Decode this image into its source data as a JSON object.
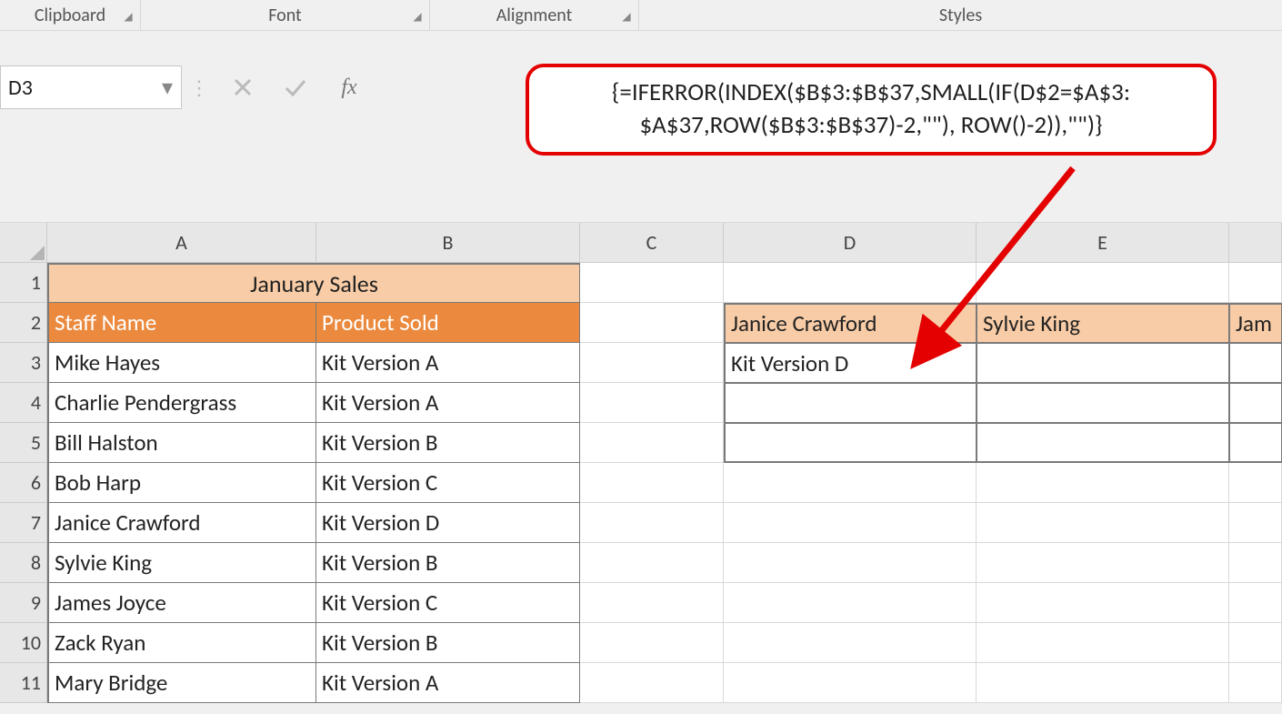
{
  "ribbon": {
    "clipboard": "Clipboard",
    "font": "Font",
    "alignment": "Alignment",
    "styles": "Styles"
  },
  "formula_bar": {
    "cell_ref": "D3",
    "fx_label": "fx",
    "formula_line1": "{=IFERROR(INDEX($B$3:$B$37,SMALL(IF(D$2=$A$3:",
    "formula_line2": "$A$37,ROW($B$3:$B$37)-2,\"\"), ROW()-2)),\"\")}"
  },
  "columns": [
    "A",
    "B",
    "C",
    "D",
    "E"
  ],
  "row_numbers": [
    "1",
    "2",
    "3",
    "4",
    "5",
    "6",
    "7",
    "8",
    "9",
    "10",
    "11"
  ],
  "grid": {
    "title": "January Sales",
    "header_a": "Staff Name",
    "header_b": "Product Sold",
    "rows": [
      {
        "a": "Mike Hayes",
        "b": "Kit Version A"
      },
      {
        "a": "Charlie Pendergrass",
        "b": "Kit Version A"
      },
      {
        "a": "Bill Halston",
        "b": "Kit Version B"
      },
      {
        "a": "Bob Harp",
        "b": "Kit Version C"
      },
      {
        "a": "Janice Crawford",
        "b": "Kit Version D"
      },
      {
        "a": "Sylvie King",
        "b": "Kit Version B"
      },
      {
        "a": "James Joyce",
        "b": "Kit Version C"
      },
      {
        "a": "Zack Ryan",
        "b": "Kit Version B"
      },
      {
        "a": "Mary Bridge",
        "b": "Kit Version A"
      }
    ],
    "lookup_d2": "Janice Crawford",
    "lookup_e2": "Sylvie King",
    "lookup_f2": "Jam",
    "lookup_d3": "Kit Version D"
  }
}
